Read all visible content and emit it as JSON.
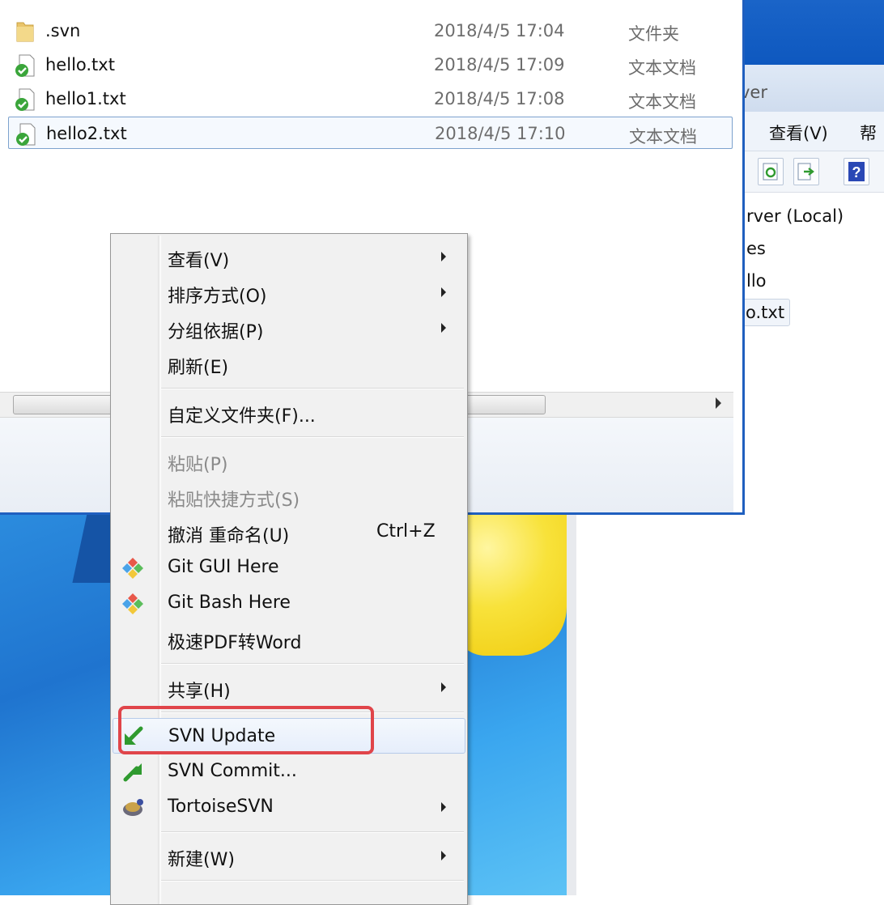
{
  "files": [
    {
      "name": ".svn",
      "date": "2018/4/5 17:04",
      "type": "文件夹",
      "icon": "folder-icon"
    },
    {
      "name": "hello.txt",
      "date": "2018/4/5 17:09",
      "type": "文本文档",
      "icon": "svn-ok-file-icon"
    },
    {
      "name": "hello1.txt",
      "date": "2018/4/5 17:08",
      "type": "文本文档",
      "icon": "svn-ok-file-icon"
    },
    {
      "name": "hello2.txt",
      "date": "2018/4/5 17:10",
      "type": "文本文档",
      "icon": "svn-ok-file-icon"
    }
  ],
  "win2": {
    "caption_fragment": "ver",
    "menu": [
      "查看(V)",
      "帮"
    ],
    "tree": [
      "rver (Local)",
      "es",
      "llo",
      "o.txt"
    ]
  },
  "context_menu": {
    "items": [
      {
        "label": "查看(V)",
        "submenu": true
      },
      {
        "label": "排序方式(O)",
        "submenu": true
      },
      {
        "label": "分组依据(P)",
        "submenu": true
      },
      {
        "label": "刷新(E)"
      },
      {
        "label": "自定义文件夹(F)..."
      },
      {
        "label": "粘贴(P)",
        "disabled": true
      },
      {
        "label": "粘贴快捷方式(S)",
        "disabled": true
      },
      {
        "label": "撤消 重命名(U)",
        "shortcut": "Ctrl+Z"
      },
      {
        "label": "Git GUI Here",
        "icon": "git-icon"
      },
      {
        "label": "Git Bash Here",
        "icon": "git-icon"
      },
      {
        "label": "极速PDF转Word"
      },
      {
        "label": "共享(H)",
        "submenu": true
      },
      {
        "label": "SVN Update",
        "icon": "svn-update-icon",
        "highlighted": true
      },
      {
        "label": "SVN Commit...",
        "icon": "svn-commit-icon"
      },
      {
        "label": "TortoiseSVN",
        "icon": "tortoisesvn-icon",
        "submenu": true
      },
      {
        "label": "新建(W)",
        "submenu": true
      }
    ]
  },
  "colors": {
    "highlight_box": "#e0454a",
    "svn_green": "#3aa53a",
    "selection_border": "#7da2ce"
  }
}
